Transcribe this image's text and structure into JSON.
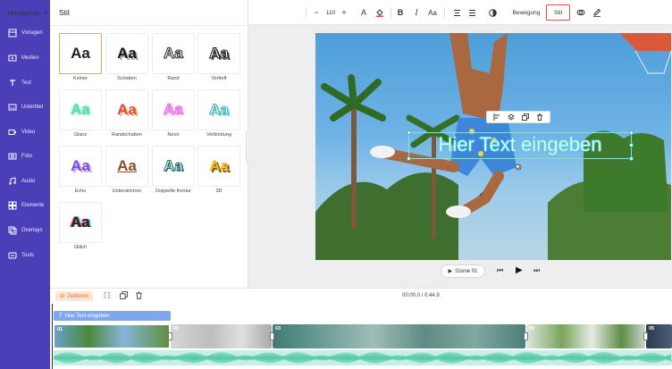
{
  "sidebar": {
    "items": [
      {
        "label": "Vorlagen",
        "icon": "templates-icon"
      },
      {
        "label": "Medien",
        "icon": "media-icon"
      },
      {
        "label": "Text",
        "icon": "text-icon"
      },
      {
        "label": "Untertitel",
        "icon": "subtitle-icon"
      },
      {
        "label": "Video",
        "icon": "video-icon"
      },
      {
        "label": "Foto",
        "icon": "photo-icon"
      },
      {
        "label": "Audio",
        "icon": "audio-icon"
      },
      {
        "label": "Elemente",
        "icon": "elements-icon"
      },
      {
        "label": "Overlays",
        "icon": "overlays-icon"
      },
      {
        "label": "Tools",
        "icon": "tools-icon"
      }
    ]
  },
  "panel": {
    "title": "Stil",
    "styles": [
      {
        "label": "Keiner",
        "sample": "Aa"
      },
      {
        "label": "Schatten",
        "sample": "Aa"
      },
      {
        "label": "Rand",
        "sample": "Aa"
      },
      {
        "label": "Vertieft",
        "sample": "Aa"
      },
      {
        "label": "Glanz",
        "sample": "Aa"
      },
      {
        "label": "Randschatten",
        "sample": "Aa"
      },
      {
        "label": "Neon",
        "sample": "Aa"
      },
      {
        "label": "Verbindung",
        "sample": "Aa"
      },
      {
        "label": "Echo",
        "sample": "Aa"
      },
      {
        "label": "Unterstrichen",
        "sample": "Aa"
      },
      {
        "label": "Doppelte Kontur",
        "sample": "Aa"
      },
      {
        "label": "3D",
        "sample": "Aa"
      },
      {
        "label": "Glitch",
        "sample": "Aa"
      }
    ],
    "selected_style": "Keiner"
  },
  "toolbar": {
    "font": "Montserrat",
    "font_size": "110",
    "minus": "−",
    "plus": "+",
    "text_color_label": "A",
    "bold": "B",
    "italic": "I",
    "case": "Aa",
    "motion": "Bewegung",
    "style": "Stil"
  },
  "canvas": {
    "text": "Hier Text eingeben",
    "scene_label": "Szene 01"
  },
  "timeline": {
    "label": "Zeitleiste",
    "time": "00:00.0 / 0:44.9",
    "text_track": "Hier Text eingeben",
    "clips": [
      "01",
      "02",
      "03",
      "04",
      "05"
    ]
  },
  "colors": {
    "sidebar": "#4a3fb7",
    "accent_orange": "#e2762c",
    "selected_style_border": "#e24a4a",
    "text_track": "#7fa6ef",
    "audio": "#c7f0e4"
  }
}
